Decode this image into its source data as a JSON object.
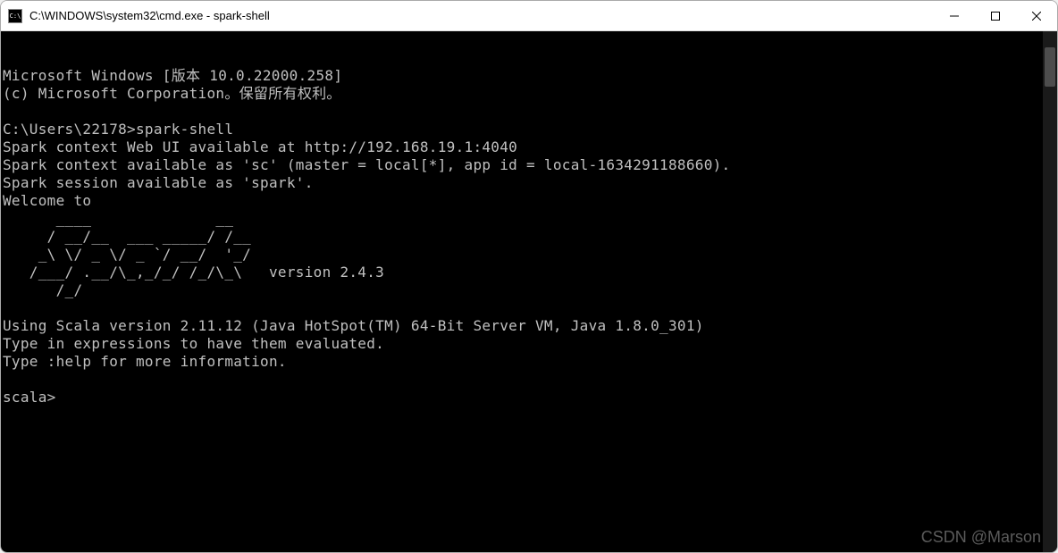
{
  "window": {
    "title": "C:\\WINDOWS\\system32\\cmd.exe - spark-shell",
    "icon_label": "C:\\"
  },
  "terminal": {
    "os_line1": "Microsoft Windows [版本 10.0.22000.258]",
    "os_line2": "(c) Microsoft Corporation。保留所有权利。",
    "prompt_path": "C:\\Users\\22178>",
    "command": "spark-shell",
    "spark_webui": "Spark context Web UI available at http://192.168.19.1:4040",
    "spark_context": "Spark context available as 'sc' (master = local[*], app id = local-1634291188660).",
    "spark_session": "Spark session available as 'spark'.",
    "welcome": "Welcome to",
    "ascii_art": "      ____              __\n     / __/__  ___ _____/ /__\n    _\\ \\/ _ \\/ _ `/ __/  '_/\n   /___/ .__/\\_,_/_/ /_/\\_\\   version 2.4.3\n      /_/",
    "scala_version": "Using Scala version 2.11.12 (Java HotSpot(TM) 64-Bit Server VM, Java 1.8.0_301)",
    "type_expr": "Type in expressions to have them evaluated.",
    "type_help": "Type :help for more information.",
    "repl_prompt": "scala>"
  },
  "watermark": "CSDN @Marson"
}
